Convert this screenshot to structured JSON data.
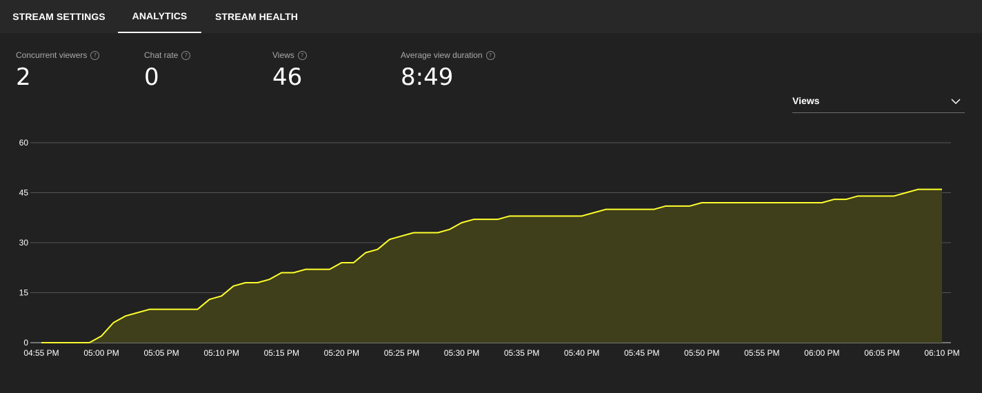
{
  "tabs": [
    {
      "label": "STREAM SETTINGS",
      "active": false
    },
    {
      "label": "ANALYTICS",
      "active": true
    },
    {
      "label": "STREAM HEALTH",
      "active": false
    }
  ],
  "stats": [
    {
      "label": "Concurrent viewers",
      "value": "2"
    },
    {
      "label": "Chat rate",
      "value": "0"
    },
    {
      "label": "Views",
      "value": "46"
    },
    {
      "label": "Average view duration",
      "value": "8:49"
    }
  ],
  "help_glyph": "?",
  "metric_select": {
    "selected": "Views"
  },
  "colors": {
    "line": "#ffff2e",
    "fill": "#3f3f1b",
    "grid": "#555555",
    "axis": "#cccccc"
  },
  "chart_data": {
    "type": "area",
    "title": "",
    "xlabel": "",
    "ylabel": "",
    "ylim": [
      0,
      60
    ],
    "yticks": [
      0,
      15,
      30,
      45,
      60
    ],
    "xlim": [
      "04:55 PM",
      "06:10 PM"
    ],
    "xticks": [
      "04:55 PM",
      "05:00 PM",
      "05:05 PM",
      "05:10 PM",
      "05:15 PM",
      "05:20 PM",
      "05:25 PM",
      "05:30 PM",
      "05:35 PM",
      "05:40 PM",
      "05:45 PM",
      "05:50 PM",
      "05:55 PM",
      "06:00 PM",
      "06:05 PM",
      "06:10 PM"
    ],
    "grid": true,
    "series": [
      {
        "x": [
          "04:55 PM",
          "04:56 PM",
          "04:57 PM",
          "04:58 PM",
          "04:59 PM",
          "05:00 PM",
          "05:01 PM",
          "05:02 PM",
          "05:03 PM",
          "05:04 PM",
          "05:05 PM",
          "05:06 PM",
          "05:07 PM",
          "05:08 PM",
          "05:09 PM",
          "05:10 PM",
          "05:11 PM",
          "05:12 PM",
          "05:13 PM",
          "05:14 PM",
          "05:15 PM",
          "05:16 PM",
          "05:17 PM",
          "05:18 PM",
          "05:19 PM",
          "05:20 PM",
          "05:21 PM",
          "05:22 PM",
          "05:23 PM",
          "05:24 PM",
          "05:25 PM",
          "05:26 PM",
          "05:27 PM",
          "05:28 PM",
          "05:29 PM",
          "05:30 PM",
          "05:31 PM",
          "05:32 PM",
          "05:33 PM",
          "05:34 PM",
          "05:35 PM",
          "05:36 PM",
          "05:37 PM",
          "05:38 PM",
          "05:39 PM",
          "05:40 PM",
          "05:41 PM",
          "05:42 PM",
          "05:43 PM",
          "05:44 PM",
          "05:45 PM",
          "05:46 PM",
          "05:47 PM",
          "05:48 PM",
          "05:49 PM",
          "05:50 PM",
          "05:51 PM",
          "05:52 PM",
          "05:53 PM",
          "05:54 PM",
          "05:55 PM",
          "05:56 PM",
          "05:57 PM",
          "05:58 PM",
          "05:59 PM",
          "06:00 PM",
          "06:01 PM",
          "06:02 PM",
          "06:03 PM",
          "06:04 PM",
          "06:05 PM",
          "06:06 PM",
          "06:07 PM",
          "06:08 PM",
          "06:09 PM",
          "06:10 PM"
        ],
        "values": [
          0,
          0,
          0,
          0,
          0,
          2,
          6,
          8,
          9,
          10,
          10,
          10,
          10,
          10,
          13,
          14,
          17,
          18,
          18,
          19,
          21,
          21,
          22,
          22,
          22,
          24,
          24,
          27,
          28,
          31,
          32,
          33,
          33,
          33,
          34,
          36,
          37,
          37,
          37,
          38,
          38,
          38,
          38,
          38,
          38,
          38,
          39,
          40,
          40,
          40,
          40,
          40,
          41,
          41,
          41,
          42,
          42,
          42,
          42,
          42,
          42,
          42,
          42,
          42,
          42,
          42,
          43,
          43,
          44,
          44,
          44,
          44,
          45,
          46,
          46,
          46
        ]
      }
    ]
  }
}
